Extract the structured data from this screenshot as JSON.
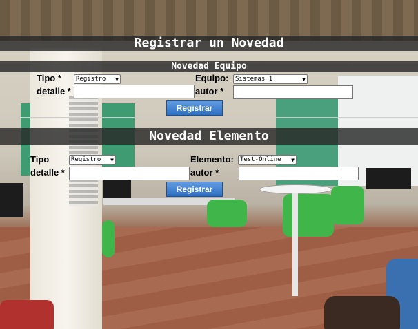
{
  "header": {
    "title": "Registrar un Novedad"
  },
  "equipo_section": {
    "title": "Novedad Equipo",
    "tipo_label": "Tipo *",
    "tipo_selected": "Registro",
    "detalle_label": "detalle *",
    "detalle_value": "",
    "equipo_label": "Equipo:",
    "equipo_selected": "Sistemas 1",
    "autor_label": "autor *",
    "autor_value": "",
    "submit_label": "Registrar"
  },
  "elemento_section": {
    "title": "Novedad Elemento",
    "tipo_label": "Tipo",
    "tipo_selected": "Registro",
    "detalle_label": "detalle *",
    "detalle_value": "",
    "elemento_label": "Elemento:",
    "elemento_selected": "Test-Online",
    "autor_label": "autor *",
    "autor_value": "",
    "submit_label": "Registrar"
  },
  "icons": {
    "dropdown": "chevron-down-icon"
  }
}
